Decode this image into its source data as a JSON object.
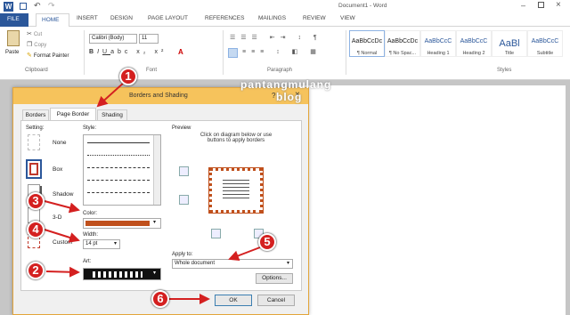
{
  "title_bar": {
    "doc_title": "Document1 - Word"
  },
  "tabs": {
    "file": "FILE",
    "home": "HOME",
    "insert": "INSERT",
    "design": "DESIGN",
    "page_layout": "PAGE LAYOUT",
    "references": "REFERENCES",
    "mailings": "MAILINGS",
    "review": "REVIEW",
    "view": "VIEW"
  },
  "clipboard": {
    "paste": "Paste",
    "cut": "Cut",
    "copy": "Copy",
    "format_painter": "Format Painter",
    "group": "Clipboard"
  },
  "font": {
    "name": "Calibri (Body)",
    "size": "11",
    "group": "Font"
  },
  "paragraph": {
    "group": "Paragraph"
  },
  "styles": {
    "group": "Styles",
    "items": [
      {
        "preview": "AaBbCcDc",
        "label": "¶ Normal"
      },
      {
        "preview": "AaBbCcDc",
        "label": "¶ No Spac..."
      },
      {
        "preview": "AaBbCcC",
        "label": "Heading 1"
      },
      {
        "preview": "AaBbCcC",
        "label": "Heading 2"
      },
      {
        "preview": "AaBl",
        "label": "Title"
      },
      {
        "preview": "AaBbCcC",
        "label": "Subtitle"
      }
    ]
  },
  "dialog": {
    "title": "Borders and Shading",
    "help": "?",
    "close": "×",
    "tabs": {
      "borders": "Borders",
      "page_border": "Page Border",
      "shading": "Shading"
    },
    "setting_label": "Setting:",
    "settings": {
      "none": "None",
      "box": "Box",
      "shadow": "Shadow",
      "three_d": "3-D",
      "custom": "Custom"
    },
    "style_label": "Style:",
    "color_label": "Color:",
    "color_value": "#c0501c",
    "width_label": "Width:",
    "width_value": "14 pt",
    "art_label": "Art:",
    "preview_label": "Preview",
    "preview_hint": "Click on diagram below or use buttons to apply borders",
    "apply_to_label": "Apply to:",
    "apply_to_value": "Whole document",
    "options_button": "Options...",
    "ok_button": "OK",
    "cancel_button": "Cancel"
  },
  "watermark": {
    "line1": "pantangmulang",
    "line2": "blog"
  },
  "annotations": [
    "1",
    "2",
    "3",
    "4",
    "5",
    "6"
  ]
}
